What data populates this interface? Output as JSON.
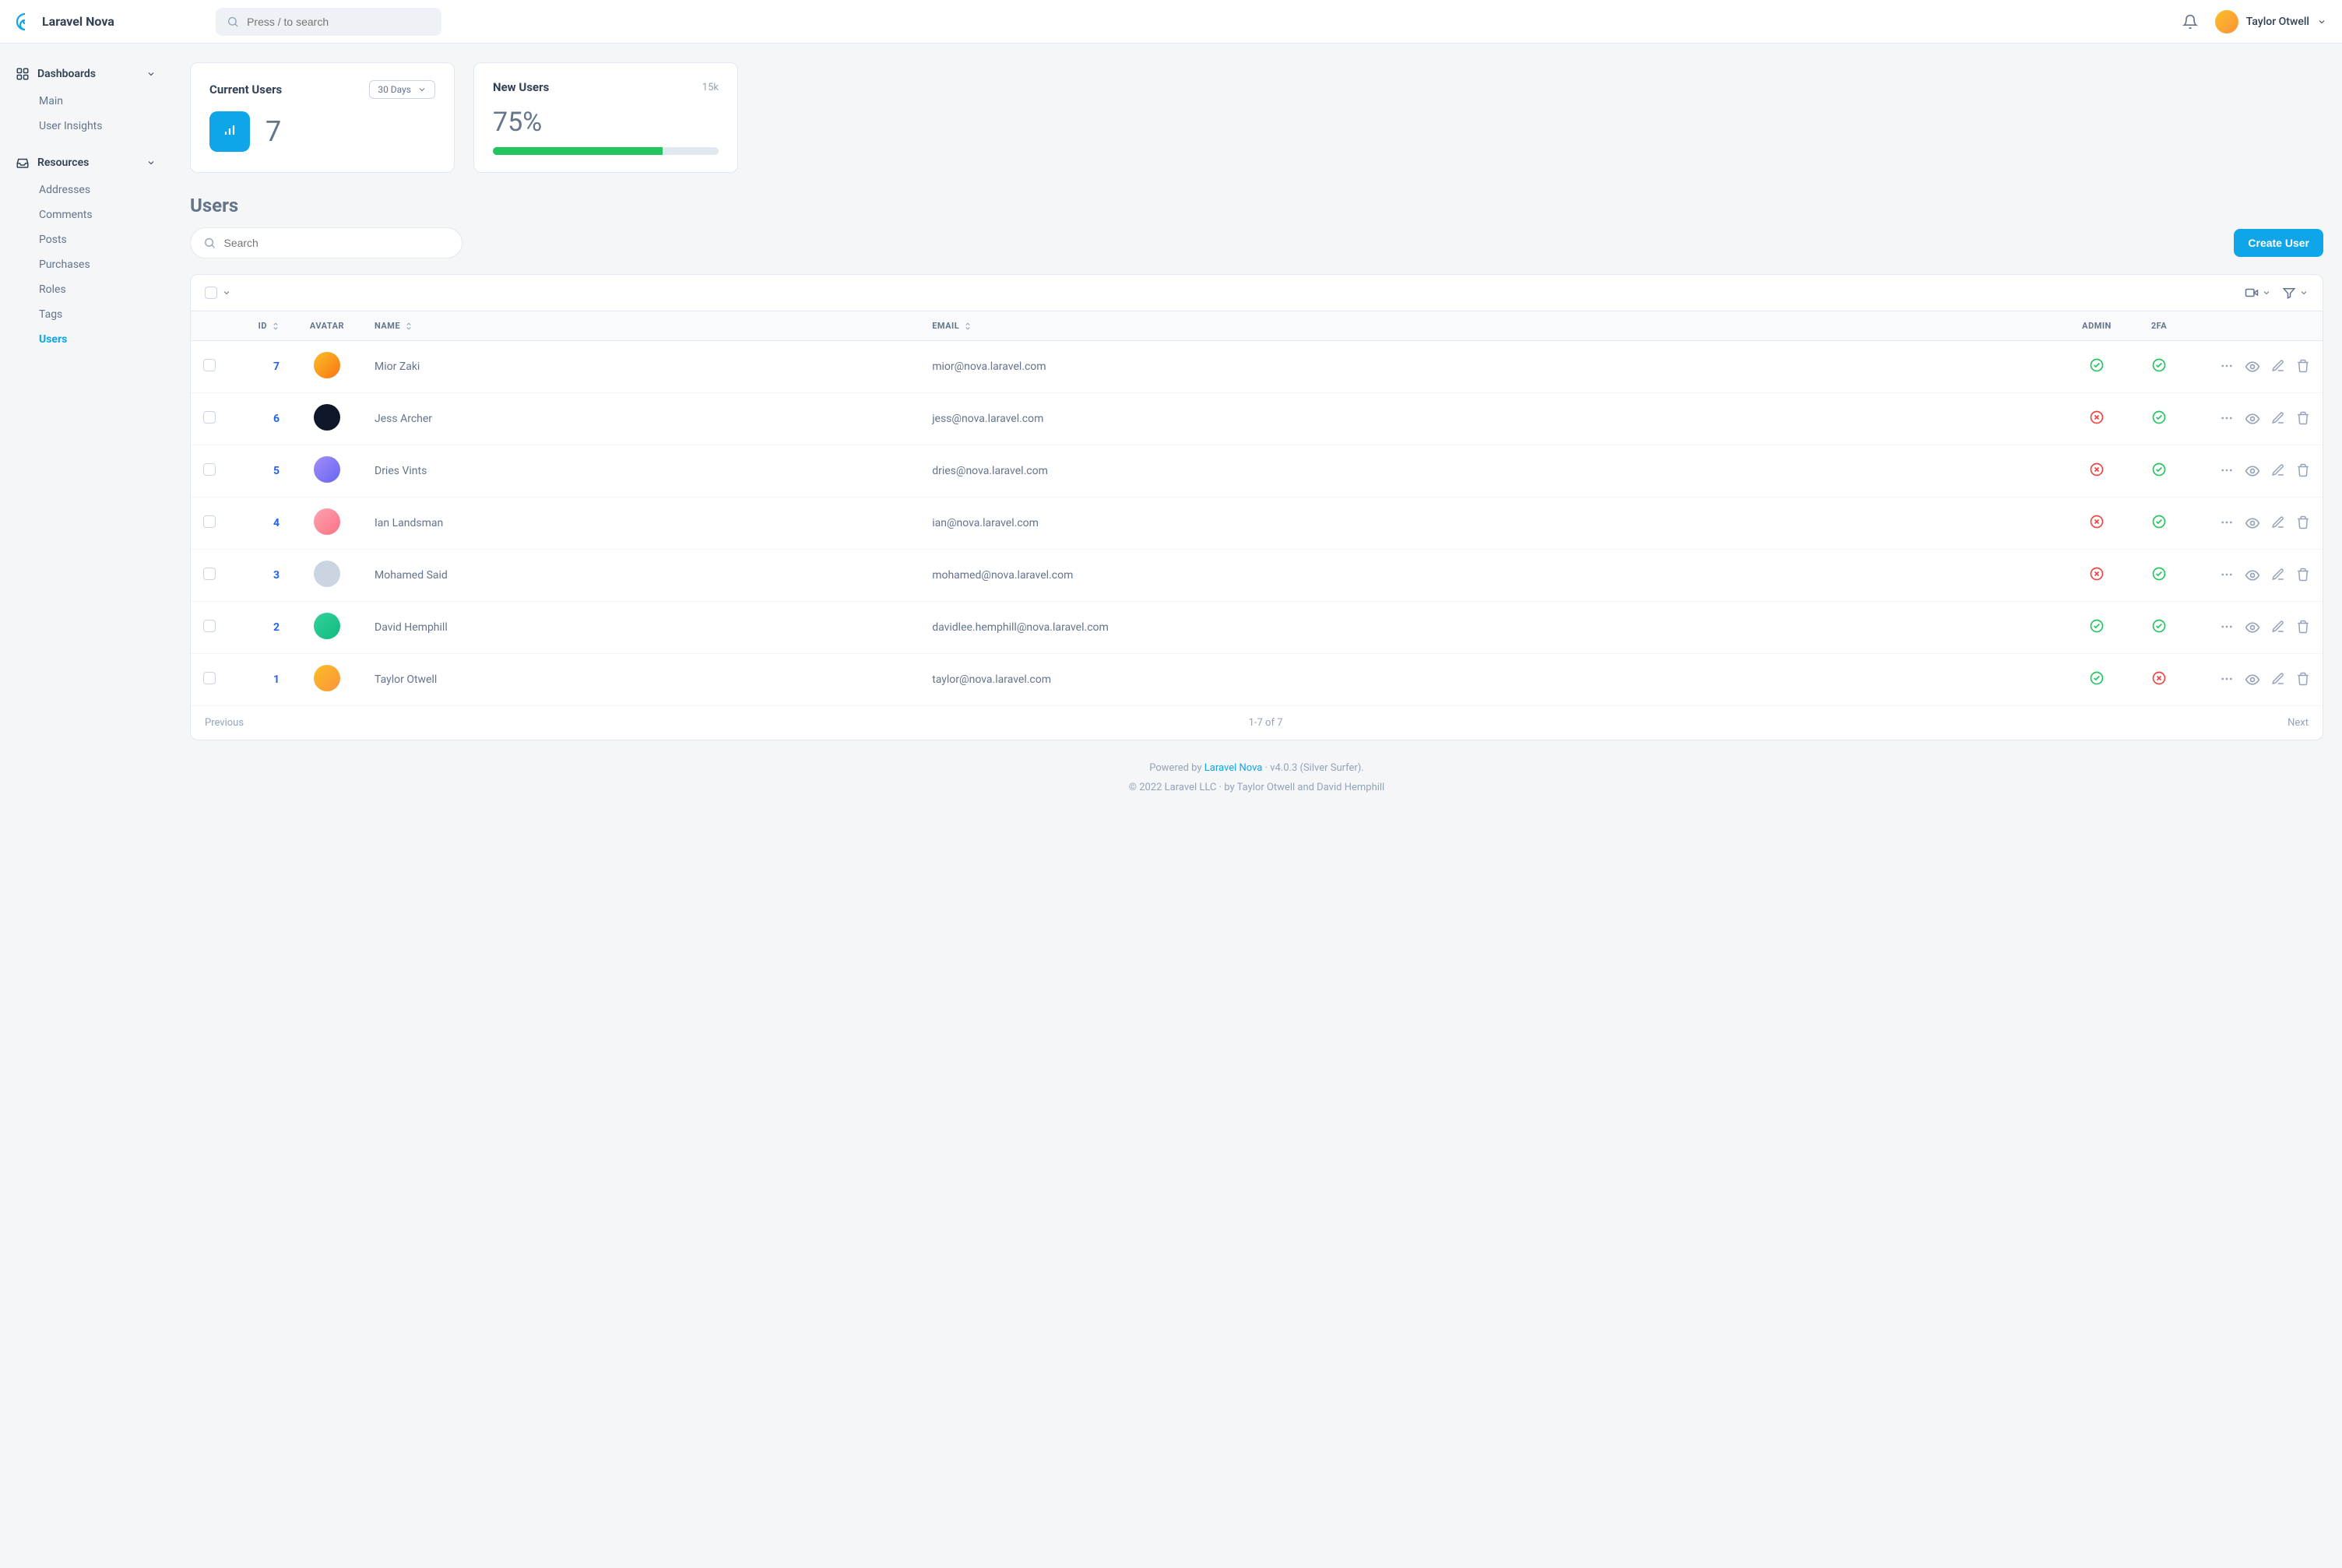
{
  "brand": "Laravel Nova",
  "global_search_placeholder": "Press / to search",
  "user_name": "Taylor Otwell",
  "sidebar": {
    "dashboards_label": "Dashboards",
    "dashboards_items": [
      "Main",
      "User Insights"
    ],
    "resources_label": "Resources",
    "resources_items": [
      "Addresses",
      "Comments",
      "Posts",
      "Purchases",
      "Roles",
      "Tags",
      "Users"
    ],
    "active_resource": "Users"
  },
  "cards": {
    "current": {
      "title": "Current Users",
      "range": "30 Days",
      "value": "7"
    },
    "new": {
      "title": "New Users",
      "stat": "15k",
      "percent": "75%",
      "fill": 75
    }
  },
  "page_title": "Users",
  "resource_search_placeholder": "Search",
  "create_button": "Create User",
  "table": {
    "columns": {
      "id": "ID",
      "avatar": "AVATAR",
      "name": "NAME",
      "email": "EMAIL",
      "admin": "ADMIN",
      "twofa": "2FA"
    },
    "rows": [
      {
        "id": "7",
        "name": "Mior Zaki",
        "email": "mior@nova.laravel.com",
        "admin": true,
        "twofa": true,
        "av": "av1"
      },
      {
        "id": "6",
        "name": "Jess Archer",
        "email": "jess@nova.laravel.com",
        "admin": false,
        "twofa": true,
        "av": "av2"
      },
      {
        "id": "5",
        "name": "Dries Vints",
        "email": "dries@nova.laravel.com",
        "admin": false,
        "twofa": true,
        "av": "av3"
      },
      {
        "id": "4",
        "name": "Ian Landsman",
        "email": "ian@nova.laravel.com",
        "admin": false,
        "twofa": true,
        "av": "av4"
      },
      {
        "id": "3",
        "name": "Mohamed Said",
        "email": "mohamed@nova.laravel.com",
        "admin": false,
        "twofa": true,
        "av": "av5"
      },
      {
        "id": "2",
        "name": "David Hemphill",
        "email": "davidlee.hemphill@nova.laravel.com",
        "admin": true,
        "twofa": true,
        "av": "av6"
      },
      {
        "id": "1",
        "name": "Taylor Otwell",
        "email": "taylor@nova.laravel.com",
        "admin": true,
        "twofa": false,
        "av": "av7"
      }
    ]
  },
  "pagination": {
    "prev": "Previous",
    "range": "1-7 of 7",
    "next": "Next"
  },
  "footer": {
    "powered_pre": "Powered by ",
    "powered_link": "Laravel Nova",
    "version": " · v4.0.3 (Silver Surfer).",
    "copyright": "© 2022 Laravel LLC · by Taylor Otwell and David Hemphill"
  }
}
